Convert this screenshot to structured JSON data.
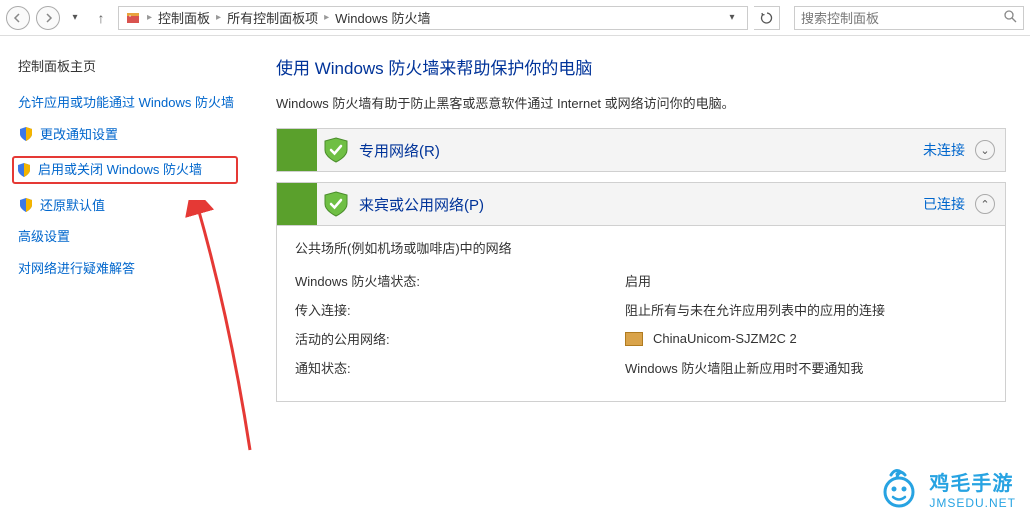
{
  "topbar": {
    "breadcrumbs": [
      "控制面板",
      "所有控制面板项",
      "Windows 防火墙"
    ],
    "search_placeholder": "搜索控制面板"
  },
  "sidebar": {
    "title": "控制面板主页",
    "links": {
      "allow": "允许应用或功能通过 Windows 防火墙",
      "notify": "更改通知设置",
      "toggle": "启用或关闭 Windows 防火墙",
      "restore": "还原默认值",
      "advanced": "高级设置",
      "troubleshoot": "对网络进行疑难解答"
    }
  },
  "main": {
    "heading": "使用 Windows 防火墙来帮助保护你的电脑",
    "description": "Windows 防火墙有助于防止黑客或恶意软件通过 Internet 或网络访问你的电脑。",
    "panels": {
      "private": {
        "title": "专用网络(R)",
        "status": "未连接"
      },
      "public": {
        "title": "来宾或公用网络(P)",
        "status": "已连接",
        "subtitle": "公共场所(例如机场或咖啡店)中的网络",
        "rows": {
          "state_label": "Windows 防火墙状态:",
          "state_value": "启用",
          "incoming_label": "传入连接:",
          "incoming_value": "阻止所有与未在允许应用列表中的应用的连接",
          "active_label": "活动的公用网络:",
          "active_value": "ChinaUnicom-SJZM2C  2",
          "notify_label": "通知状态:",
          "notify_value": "Windows 防火墙阻止新应用时不要通知我"
        }
      }
    }
  },
  "watermark": {
    "line1": "鸡毛手游",
    "line2": "JMSEDU.NET"
  }
}
